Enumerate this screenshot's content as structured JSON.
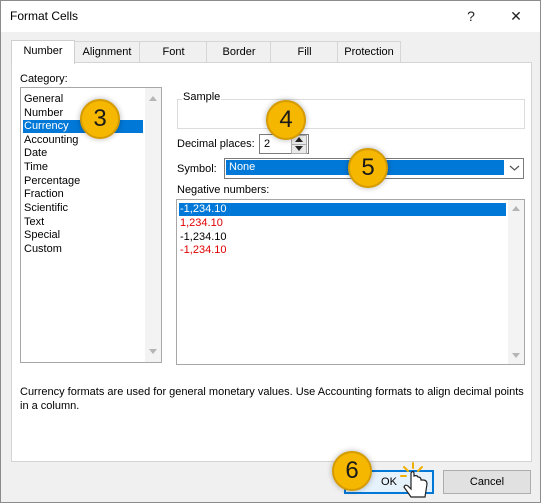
{
  "window": {
    "title": "Format Cells",
    "help": "?",
    "close": "✕"
  },
  "tabs": [
    "Number",
    "Alignment",
    "Font",
    "Border",
    "Fill",
    "Protection"
  ],
  "category": {
    "label": "Category:",
    "items": [
      "General",
      "Number",
      "Currency",
      "Accounting",
      "Date",
      "Time",
      "Percentage",
      "Fraction",
      "Scientific",
      "Text",
      "Special",
      "Custom"
    ],
    "selected": "Currency"
  },
  "sample": {
    "label": "Sample"
  },
  "decimal": {
    "label": "Decimal places:",
    "value": "2"
  },
  "symbol": {
    "label": "Symbol:",
    "value": "None"
  },
  "negative": {
    "label": "Negative numbers:",
    "items": [
      "-1,234.10",
      "1,234.10",
      "-1,234.10",
      "-1,234.10"
    ]
  },
  "description": "Currency formats are used for general monetary values.  Use Accounting formats to align decimal points in a column.",
  "buttons": {
    "ok": "OK",
    "cancel": "Cancel"
  },
  "badges": [
    "3",
    "4",
    "5",
    "6"
  ],
  "colors": {
    "selection": "#0078d7",
    "badge": "#f5b700",
    "negative_red": "#e00000"
  },
  "icons": {
    "cursor": "hand-pointer-icon"
  }
}
